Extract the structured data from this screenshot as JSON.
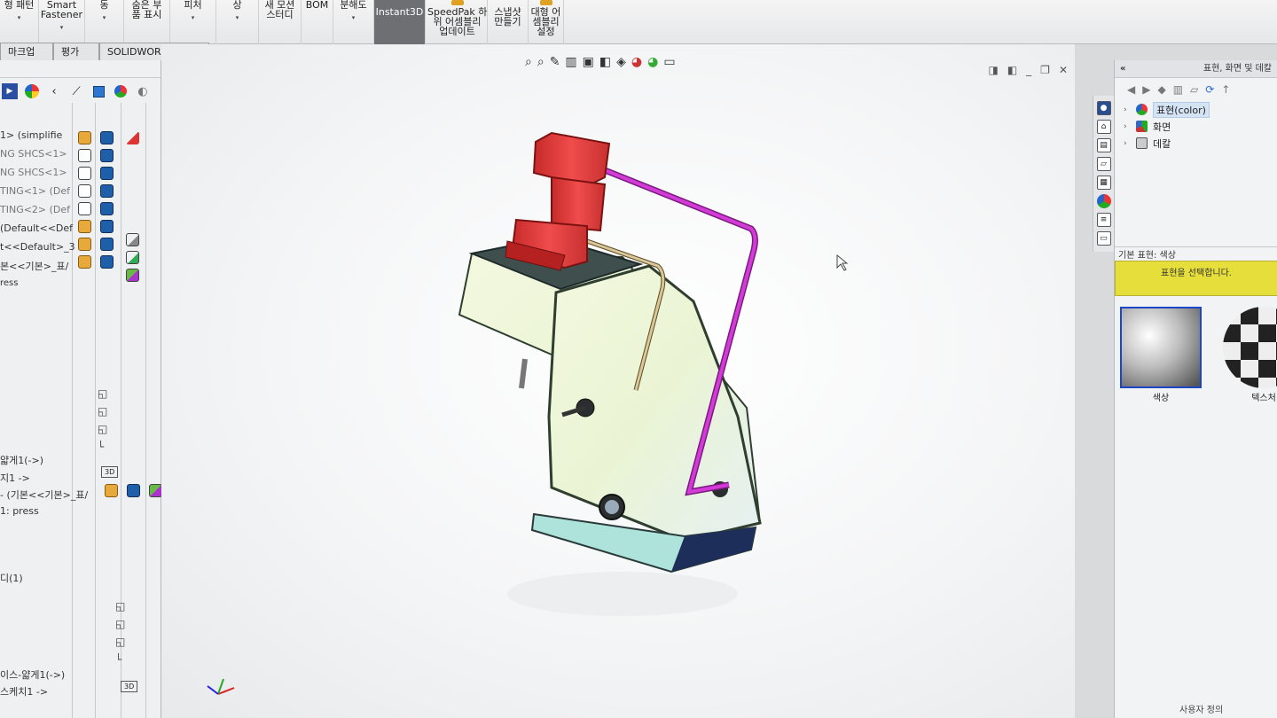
{
  "ribbon": {
    "buttons": [
      {
        "label": "형 패턴",
        "arrow": "▾"
      },
      {
        "label": "Smart\nFastener",
        "arrow": "▾"
      },
      {
        "label": "동",
        "arrow": "▾"
      },
      {
        "label": "숨은 부\n품 표시",
        "arrow": ""
      },
      {
        "label": "피처",
        "arrow": "▾"
      },
      {
        "label": "상",
        "arrow": "▾"
      },
      {
        "label": "새 모션\n스터디",
        "arrow": ""
      },
      {
        "label": "BOM",
        "arrow": ""
      },
      {
        "label": "분해도",
        "arrow": "▾"
      },
      {
        "label": "Instant3D",
        "arrow": ""
      },
      {
        "label": "SpeedPak 하\n위 어셈블리\n업데이트",
        "arrow": ""
      },
      {
        "label": "스냅샷\n만들기",
        "arrow": ""
      },
      {
        "label": "대형 어\n셈블리\n설정",
        "arrow": ""
      }
    ]
  },
  "tabs": [
    {
      "label": "마크업"
    },
    {
      "label": "평가"
    },
    {
      "label": "SOLIDWORKS 애드인"
    }
  ],
  "tree": {
    "items": [
      "1> (simplifie",
      "NG SHCS<1>",
      "NG SHCS<1>",
      "TING<1> (Def",
      "TING<2> (Def",
      "(Default<<Def",
      "t<<Default>_3",
      "본<<기본>_표/",
      "ress",
      "얇게1(->)",
      "지1 ->",
      "- (기본<<기본>_표/",
      "1: press",
      "디(1)",
      "이스-얇게1(->)",
      "스케치1 ->"
    ],
    "badge_3d": "3D"
  },
  "right_panel": {
    "title": "표현, 화면 및 데칼",
    "tree": [
      {
        "label": "표현(color)",
        "selected": true
      },
      {
        "label": "화면",
        "selected": false
      },
      {
        "label": "데칼",
        "selected": false
      }
    ],
    "section_label": "기본 표현: 색상",
    "hint": "표현을 선택합니다.",
    "thumbs": [
      {
        "label": "색상"
      },
      {
        "label": "텍스처"
      }
    ],
    "footer": "사용자 정의"
  },
  "colors": {
    "accent_blue": "#1c46c8",
    "fixture_red": "#e53a3a",
    "rod_magenta": "#d23bd6",
    "body_pale": "#eef4d8"
  }
}
